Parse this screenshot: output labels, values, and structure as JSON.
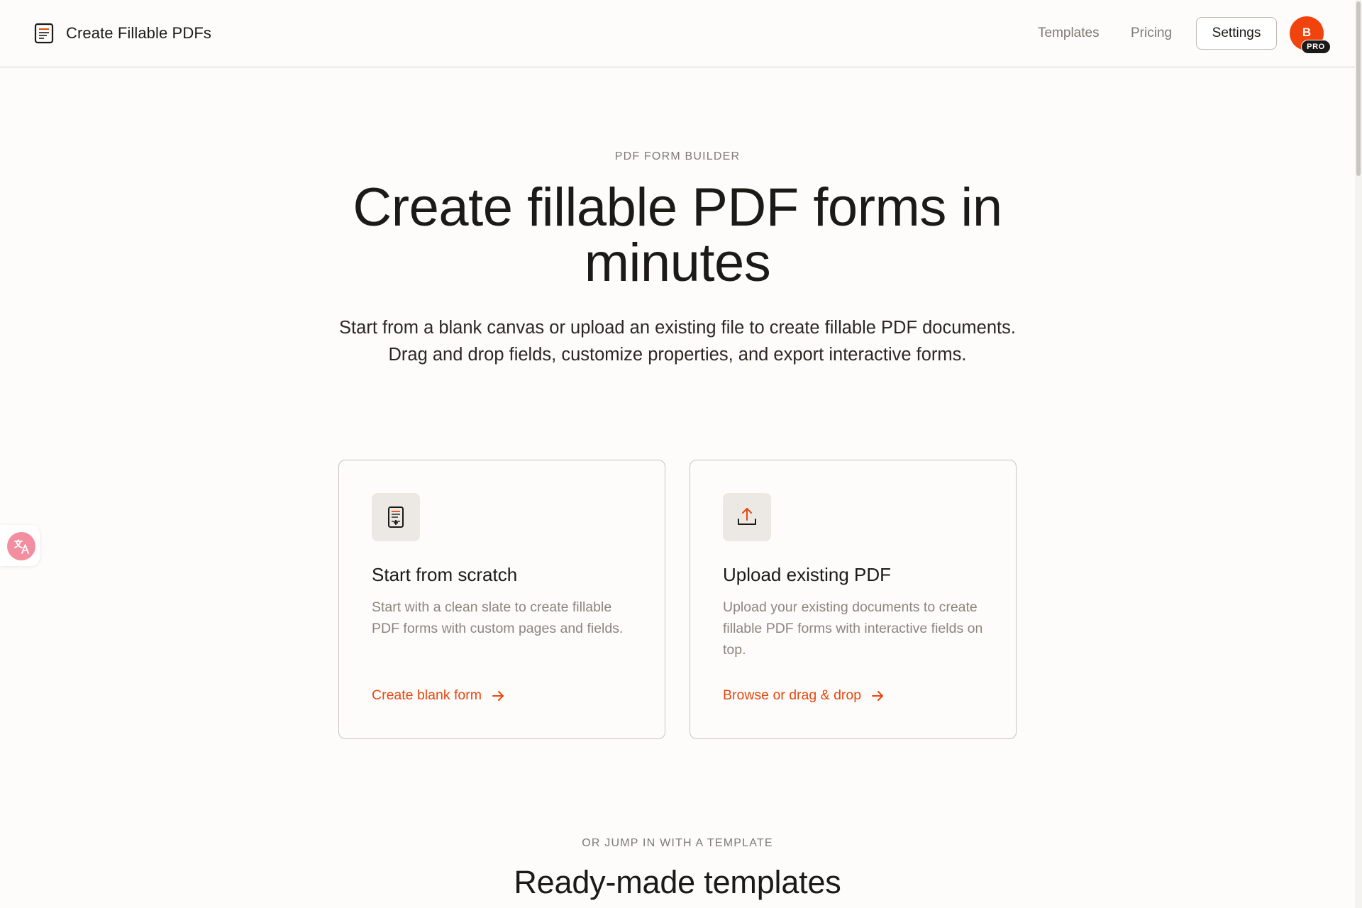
{
  "header": {
    "brand_title": "Create Fillable PDFs",
    "nav": {
      "templates": "Templates",
      "pricing": "Pricing",
      "settings": "Settings"
    },
    "avatar_initial": "B",
    "plan_badge": "PRO"
  },
  "hero": {
    "eyebrow": "PDF FORM BUILDER",
    "title": "Create fillable PDF forms in minutes",
    "subtitle": "Start from a blank canvas or upload an existing file to create fillable PDF documents. Drag and drop fields, customize properties, and export interactive forms."
  },
  "cards": [
    {
      "icon": "form-document-icon",
      "title": "Start from scratch",
      "description": "Start with a clean slate to create fillable PDF forms with custom pages and fields.",
      "link": "Create blank form"
    },
    {
      "icon": "upload-icon",
      "title": "Upload existing PDF",
      "description": "Upload your existing documents to create fillable PDF forms with interactive fields on top.",
      "link": "Browse or drag & drop"
    }
  ],
  "templates_section": {
    "eyebrow": "OR JUMP IN WITH A TEMPLATE",
    "title": "Ready-made templates"
  },
  "colors": {
    "accent": "#e8470f",
    "avatar_bg": "#f0430e",
    "background": "#fdfcfa",
    "text": "#1c1a17",
    "muted": "#8a8680",
    "widget_pink": "#f28ea0"
  }
}
